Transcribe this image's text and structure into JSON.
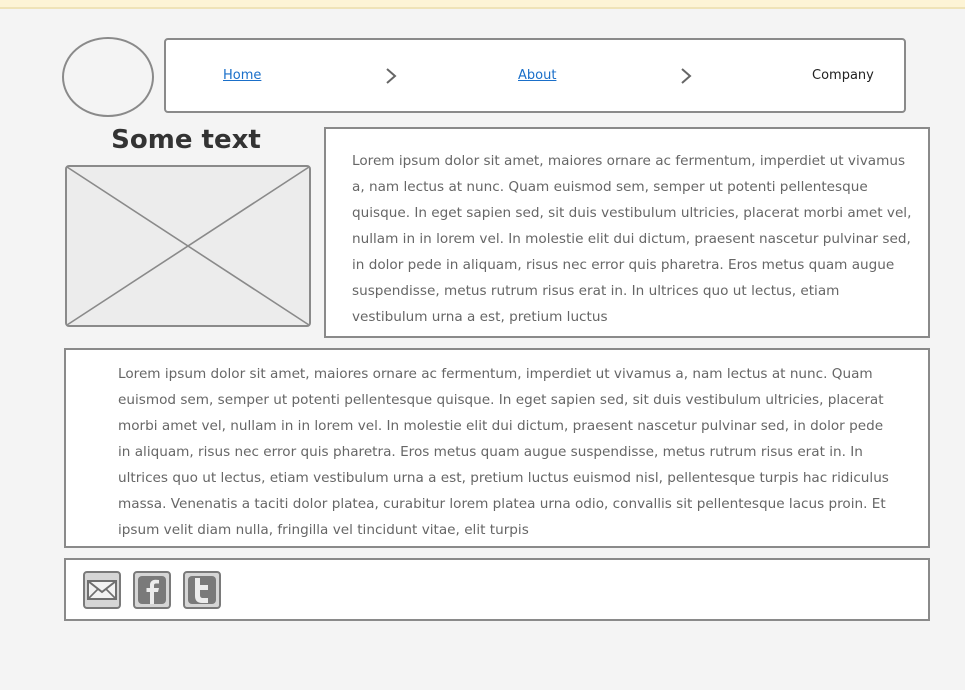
{
  "breadcrumb": {
    "items": [
      {
        "label": "Home",
        "link": true
      },
      {
        "label": "About",
        "link": true
      },
      {
        "label": "Company",
        "link": false
      }
    ]
  },
  "content": {
    "heading": "Some text",
    "paragraph_1": "Lorem ipsum dolor sit amet, maiores ornare ac fermentum, imperdiet ut vivamus a, nam lectus at nunc. Quam euismod sem, semper ut potenti pellentesque quisque. In eget sapien sed, sit duis vestibulum ultricies, placerat morbi amet vel, nullam in in lorem vel. In molestie elit dui dictum, praesent nascetur pulvinar sed, in dolor pede in aliquam, risus nec error quis pharetra. Eros metus quam augue suspendisse, metus rutrum risus erat in. In ultrices quo ut lectus, etiam vestibulum urna a est, pretium luctus",
    "paragraph_2": "Lorem ipsum dolor sit amet, maiores ornare ac fermentum, imperdiet ut vivamus a, nam lectus at nunc. Quam euismod sem, semper ut potenti pellentesque quisque. In eget sapien sed, sit duis vestibulum ultricies, placerat morbi amet vel, nullam in in lorem vel. In molestie elit dui dictum, praesent nascetur pulvinar sed, in dolor pede in aliquam, risus nec error quis pharetra. Eros metus quam augue suspendisse, metus rutrum risus erat in.  In ultrices quo ut lectus, etiam vestibulum urna a est, pretium luctus euismod nisl, pellentesque turpis hac ridiculus massa. Venenatis a taciti dolor platea, curabitur lorem platea urna odio, convallis sit pellentesque lacus proin. Et ipsum velit diam nulla, fringilla vel tincidunt vitae, elit turpis"
  },
  "social": {
    "icons": [
      "email-icon",
      "facebook-icon",
      "twitter-icon"
    ]
  },
  "colors": {
    "link": "#1a6fc9",
    "border": "#8a8a8a",
    "text": "#666666",
    "background": "#f4f4f4",
    "top_bar": "#fdf4d6"
  }
}
